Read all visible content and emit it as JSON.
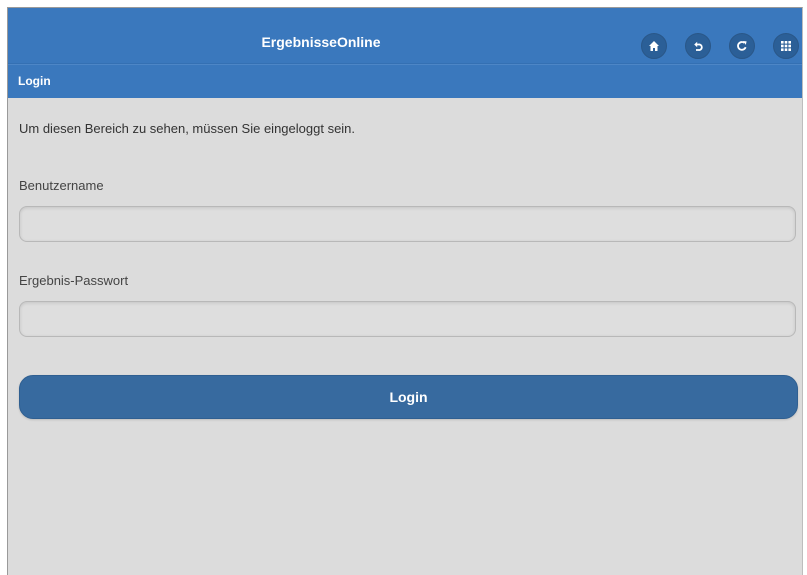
{
  "header": {
    "title": "ErgebnisseOnline",
    "buttons": [
      {
        "icon": "home-icon"
      },
      {
        "icon": "back-icon"
      },
      {
        "icon": "refresh-icon"
      },
      {
        "icon": "grid-menu-icon"
      }
    ]
  },
  "subheader": {
    "title": "Login"
  },
  "form": {
    "notice": "Um diesen Bereich zu sehen, müssen Sie eingeloggt sein.",
    "username_label": "Benutzername",
    "username_value": "",
    "password_label": "Ergebnis-Passwort",
    "password_value": "",
    "submit_label": "Login"
  },
  "colors": {
    "header_bg": "#3a78bd",
    "button_bg": "#376a9f",
    "page_bg": "#dcdcdc"
  }
}
